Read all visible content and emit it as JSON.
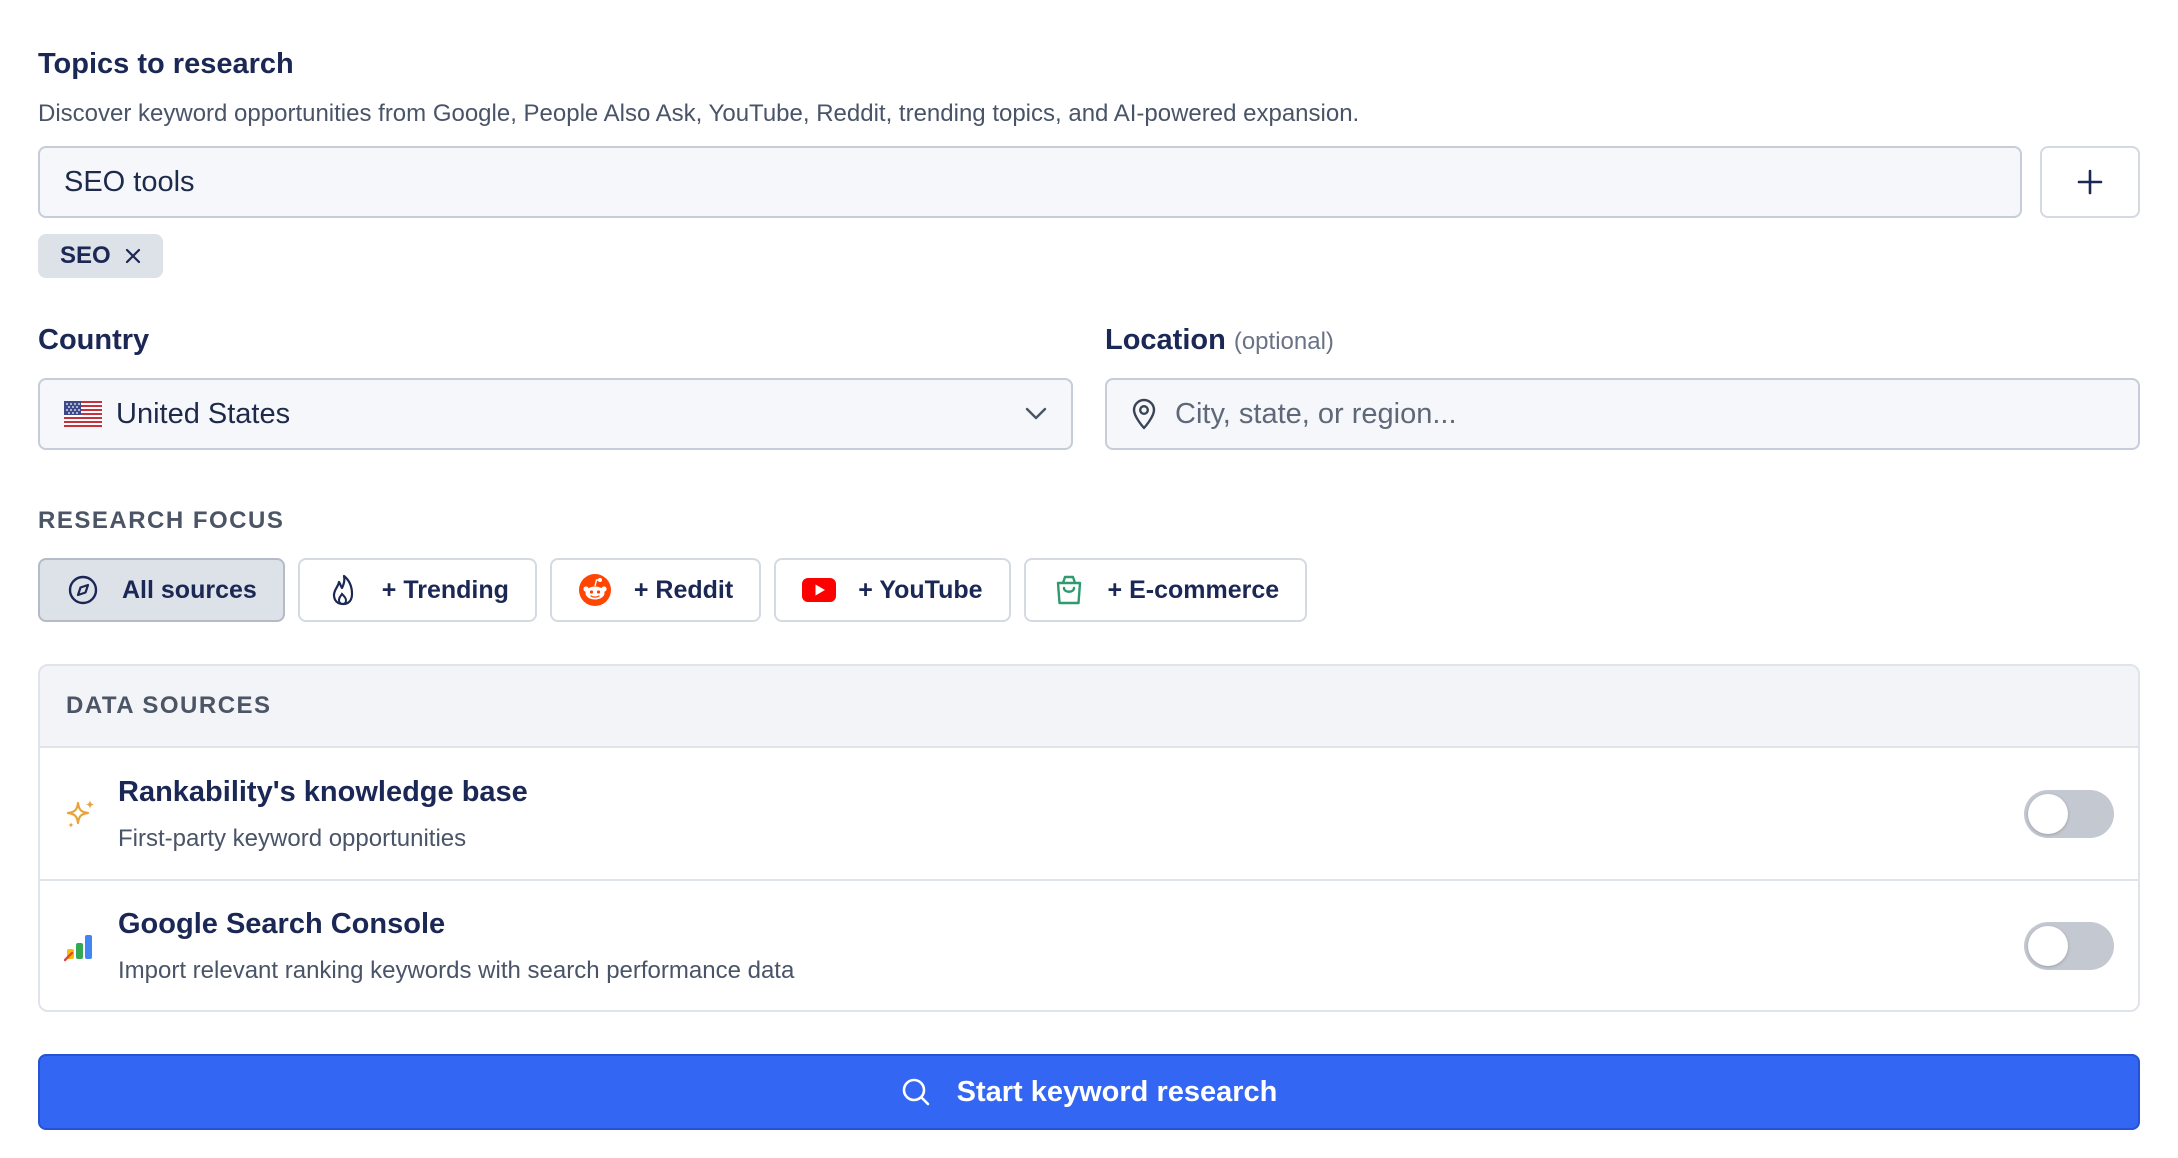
{
  "topics": {
    "title": "Topics to research",
    "description": "Discover keyword opportunities from Google, People Also Ask, YouTube, Reddit, trending topics, and AI-powered expansion.",
    "input_value": "SEO tools",
    "add_icon": "plus-icon",
    "tags": [
      {
        "label": "SEO",
        "remove_icon": "close-icon"
      }
    ]
  },
  "country": {
    "label": "Country",
    "selected": "United States",
    "flag_icon": "us-flag-icon",
    "chevron_icon": "chevron-down-icon"
  },
  "location": {
    "label": "Location",
    "optional_note": "(optional)",
    "placeholder": "City, state, or region...",
    "icon": "map-pin-icon"
  },
  "research_focus": {
    "title": "RESEARCH FOCUS",
    "chips": [
      {
        "label": "All sources",
        "icon": "compass-icon",
        "active": true
      },
      {
        "label": "+ Trending",
        "icon": "flame-icon",
        "active": false
      },
      {
        "label": "+ Reddit",
        "icon": "reddit-icon",
        "active": false
      },
      {
        "label": "+ YouTube",
        "icon": "youtube-icon",
        "active": false
      },
      {
        "label": "+ E-commerce",
        "icon": "shopping-bag-icon",
        "active": false
      }
    ]
  },
  "data_sources": {
    "title": "DATA SOURCES",
    "items": [
      {
        "title": "Rankability's knowledge base",
        "subtitle": "First-party keyword opportunities",
        "icon": "sparkles-icon",
        "enabled": false
      },
      {
        "title": "Google Search Console",
        "subtitle": "Import relevant ranking keywords with search performance data",
        "icon": "google-search-console-icon",
        "enabled": false
      }
    ]
  },
  "cta": {
    "label": "Start keyword research",
    "icon": "search-icon"
  },
  "colors": {
    "primary": "#3366f2",
    "heading": "#1b2754",
    "toggle_off": "#c3c8d1",
    "reddit": "#ff4500",
    "youtube": "#ff0000",
    "ecommerce": "#2e9a6e",
    "sparkle": "#e8a33a"
  }
}
